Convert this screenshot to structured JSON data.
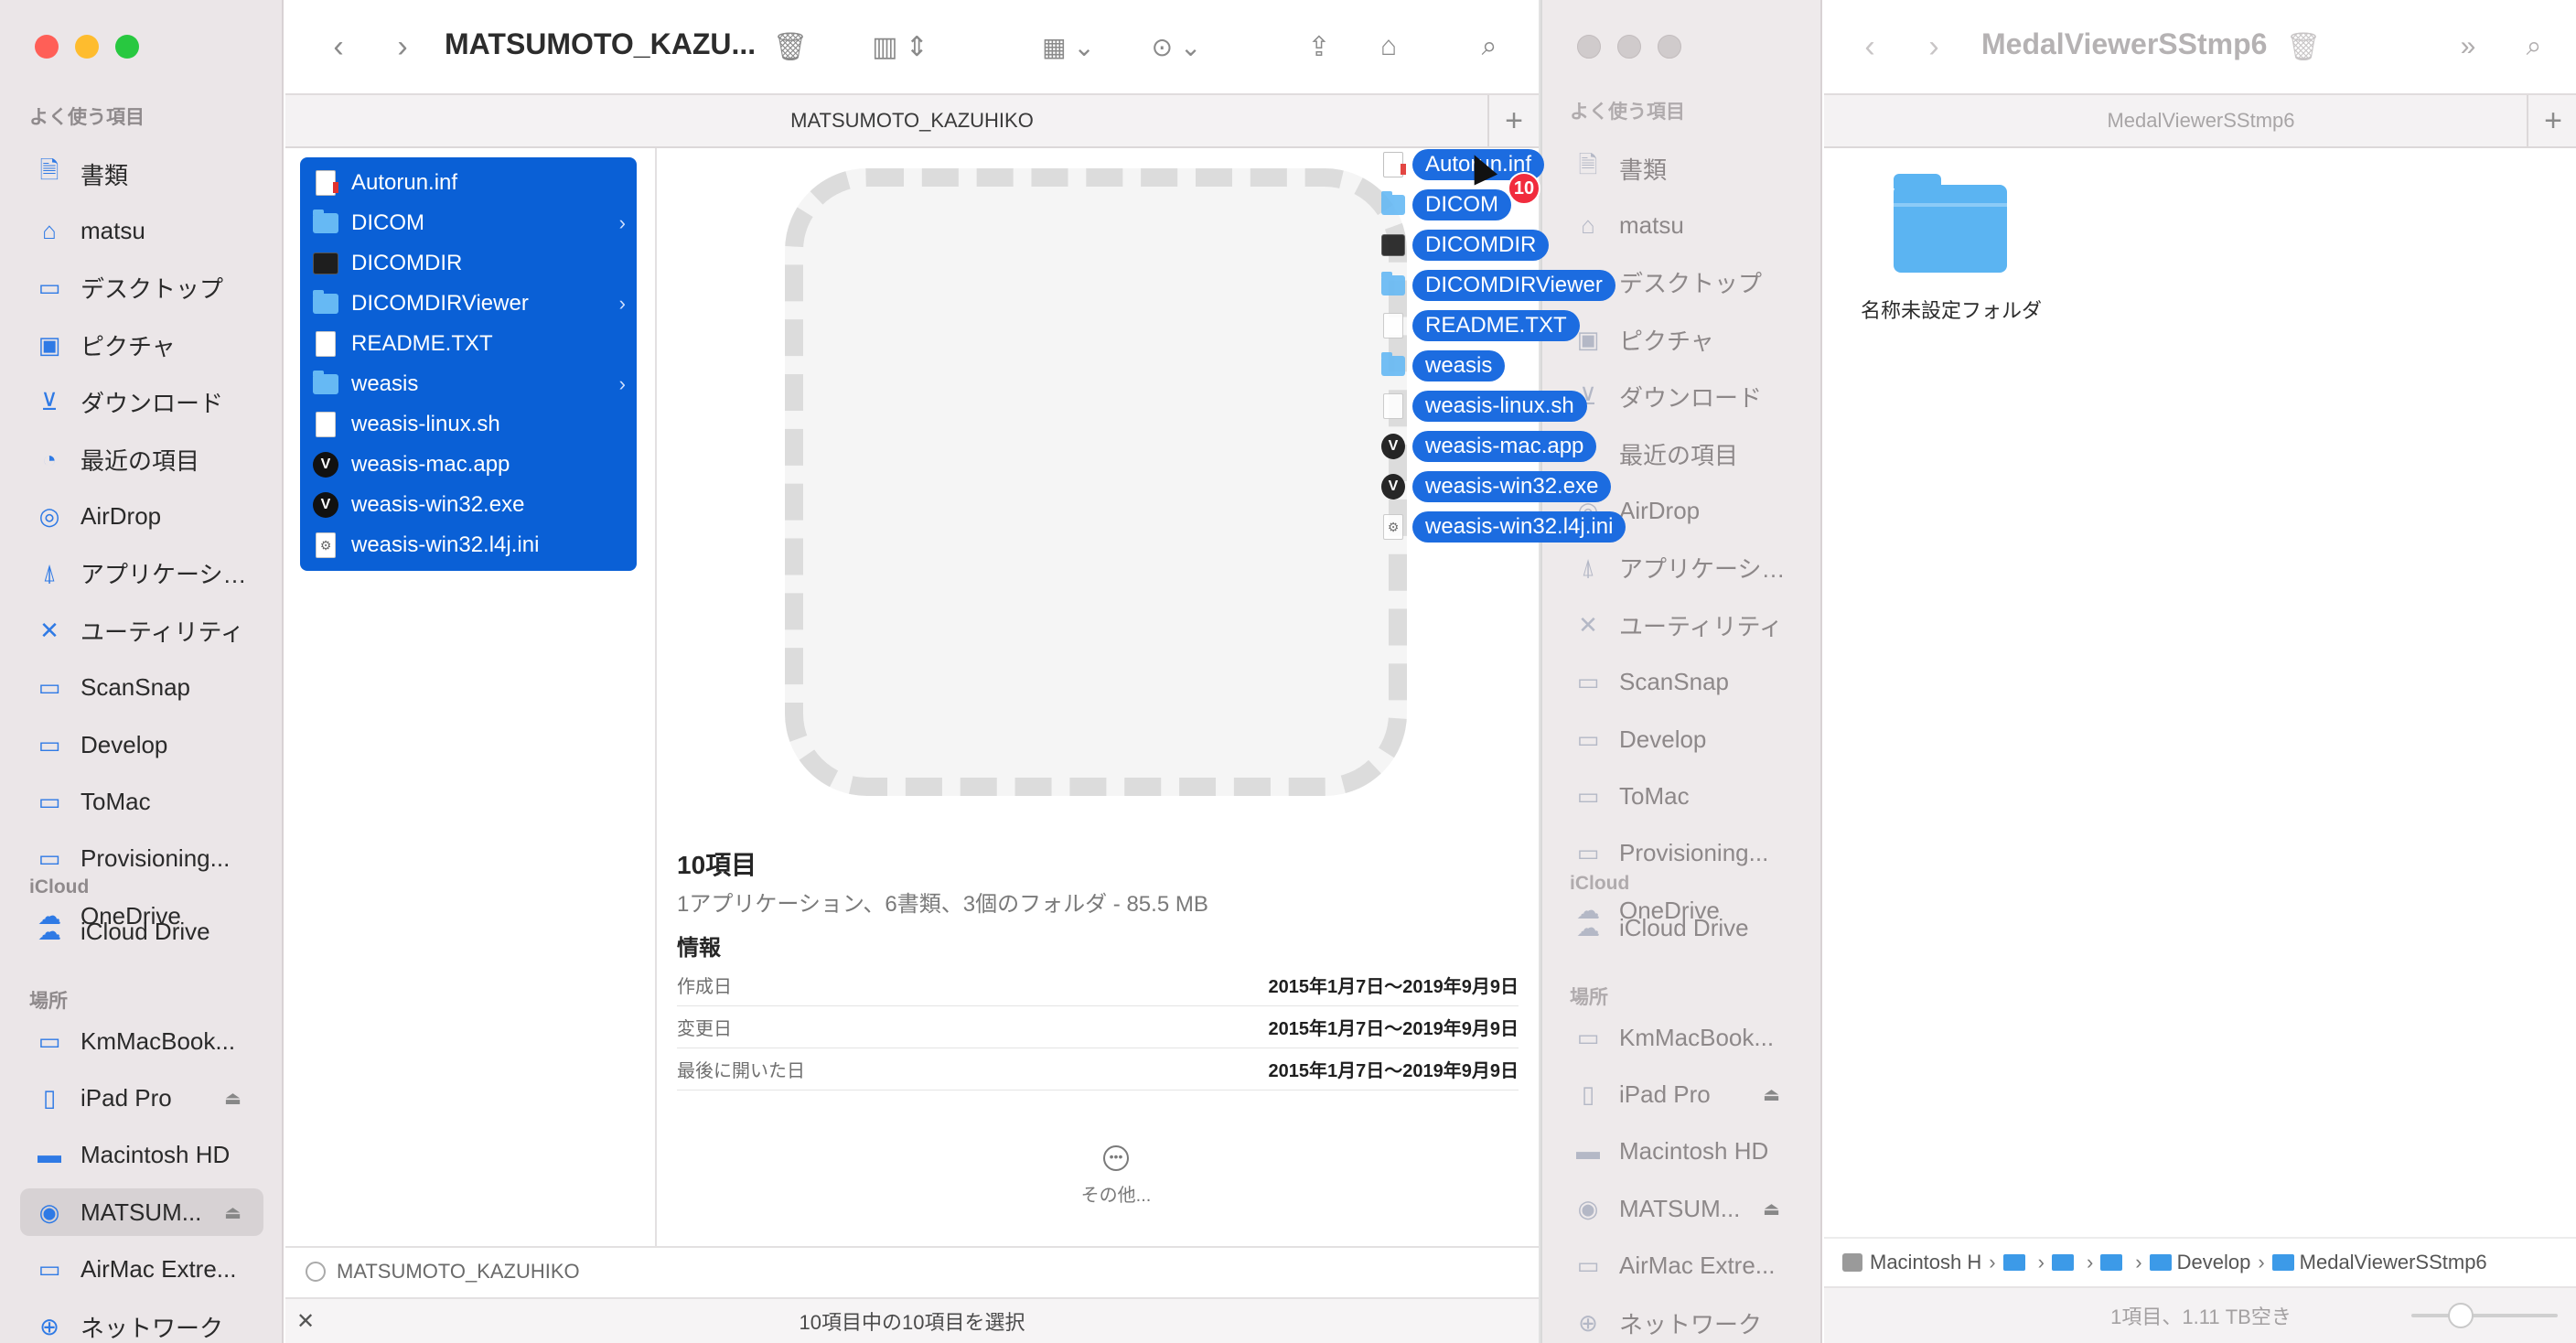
{
  "left_window": {
    "title": "MATSUMOTO_KAZU...",
    "tab_label": "MATSUMOTO_KAZUHIKO",
    "sidebar": {
      "favorites_header": "よく使う項目",
      "favorites": [
        {
          "label": "書類",
          "icon": "document-icon"
        },
        {
          "label": "matsu",
          "icon": "home-icon"
        },
        {
          "label": "デスクトップ",
          "icon": "desktop-icon"
        },
        {
          "label": "ピクチャ",
          "icon": "pictures-icon"
        },
        {
          "label": "ダウンロード",
          "icon": "download-icon"
        },
        {
          "label": "最近の項目",
          "icon": "clock-icon"
        },
        {
          "label": "AirDrop",
          "icon": "airdrop-icon"
        },
        {
          "label": "アプリケーシ…",
          "icon": "applications-icon"
        },
        {
          "label": "ユーティリティ",
          "icon": "utilities-icon"
        },
        {
          "label": "ScanSnap",
          "icon": "folder-icon"
        },
        {
          "label": "Develop",
          "icon": "folder-icon"
        },
        {
          "label": "ToMac",
          "icon": "folder-icon"
        },
        {
          "label": "Provisioning...",
          "icon": "folder-icon"
        },
        {
          "label": "OneDrive",
          "icon": "cloud-icon"
        }
      ],
      "icloud_header": "iCloud",
      "icloud": [
        {
          "label": "iCloud Drive",
          "icon": "icloud-icon"
        }
      ],
      "locations_header": "場所",
      "locations": [
        {
          "label": "KmMacBook...",
          "icon": "laptop-icon"
        },
        {
          "label": "iPad Pro",
          "icon": "ipad-icon"
        },
        {
          "label": "Macintosh HD",
          "icon": "disk-icon"
        },
        {
          "label": "MATSUM...",
          "icon": "cd-icon"
        },
        {
          "label": "AirMac Extre...",
          "icon": "monitor-icon"
        },
        {
          "label": "ネットワーク",
          "icon": "network-icon"
        }
      ]
    },
    "files": [
      {
        "name": "Autorun.inf",
        "type": "inf"
      },
      {
        "name": "DICOM",
        "type": "folder"
      },
      {
        "name": "DICOMDIR",
        "type": "exec"
      },
      {
        "name": "DICOMDIRViewer",
        "type": "folder"
      },
      {
        "name": "README.TXT",
        "type": "doc"
      },
      {
        "name": "weasis",
        "type": "folder"
      },
      {
        "name": "weasis-linux.sh",
        "type": "doc"
      },
      {
        "name": "weasis-mac.app",
        "type": "app"
      },
      {
        "name": "weasis-win32.exe",
        "type": "app"
      },
      {
        "name": "weasis-win32.l4j.ini",
        "type": "config"
      }
    ],
    "drag_badge": "10",
    "preview": {
      "title": "10項目",
      "subtitle": "1アプリケーション、6書類、3個のフォルダ - 85.5 MB",
      "info_header": "情報",
      "rows": [
        {
          "key": "作成日",
          "value": "2015年1月7日〜2019年9月9日"
        },
        {
          "key": "変更日",
          "value": "2015年1月7日〜2019年9月9日"
        },
        {
          "key": "最後に開いた日",
          "value": "2015年1月7日〜2019年9月9日"
        }
      ],
      "more_label": "その他..."
    },
    "path_label": "MATSUMOTO_KAZUHIKO",
    "status": "10項目中の10項目を選択"
  },
  "right_window": {
    "title": "MedalViewerSStmp6",
    "tab_label": "MedalViewerSStmp6",
    "sidebar": {
      "favorites_header": "よく使う項目",
      "favorites": [
        {
          "label": "書類"
        },
        {
          "label": "matsu"
        },
        {
          "label": "デスクトップ"
        },
        {
          "label": "ピクチャ"
        },
        {
          "label": "ダウンロード"
        },
        {
          "label": "最近の項目"
        },
        {
          "label": "AirDrop"
        },
        {
          "label": "アプリケーシ…"
        },
        {
          "label": "ユーティリティ"
        },
        {
          "label": "ScanSnap"
        },
        {
          "label": "Develop"
        },
        {
          "label": "ToMac"
        },
        {
          "label": "Provisioning..."
        },
        {
          "label": "OneDrive"
        }
      ],
      "icloud_header": "iCloud",
      "icloud": [
        {
          "label": "iCloud Drive"
        }
      ],
      "locations_header": "場所",
      "locations": [
        {
          "label": "KmMacBook..."
        },
        {
          "label": "iPad Pro"
        },
        {
          "label": "Macintosh HD"
        },
        {
          "label": "MATSUM..."
        },
        {
          "label": "AirMac Extre..."
        },
        {
          "label": "ネットワーク"
        }
      ]
    },
    "folder_name": "名称未設定フォルダ",
    "path": {
      "root": "Macintosh H",
      "develop": "Develop",
      "current": "MedalViewerSStmp6"
    },
    "status": "1項目、1.11 TB空き"
  },
  "colors": {
    "selection": "#0a60d6",
    "accent": "#2f7ae5",
    "badge": "#f12c3d",
    "folder": "#66b9f4"
  }
}
